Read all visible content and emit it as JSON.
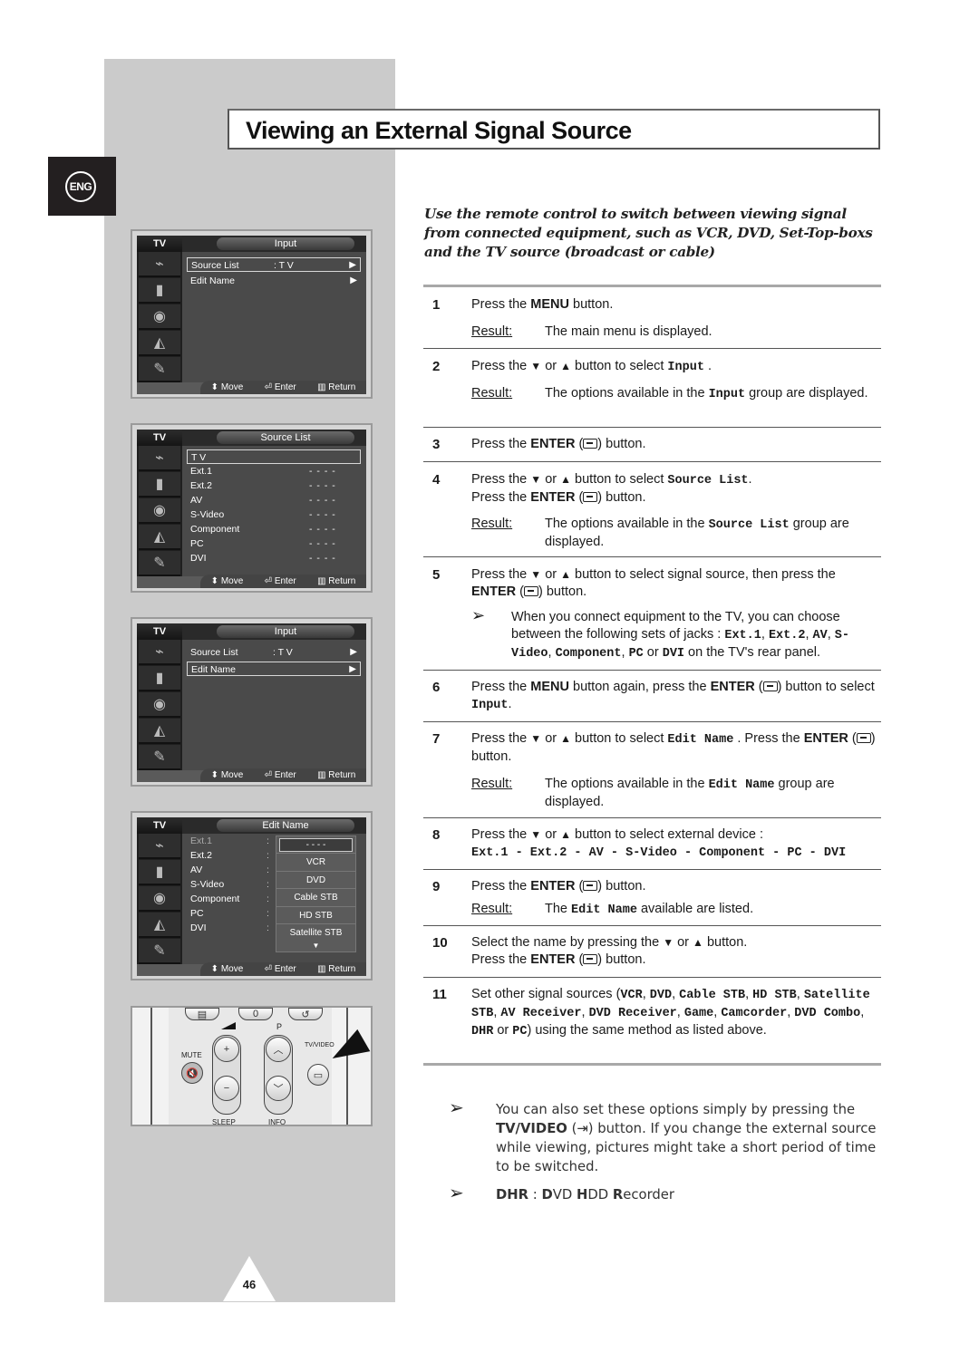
{
  "page": {
    "title": "Viewing an External Signal Source",
    "language_badge": "ENG",
    "page_number": "46"
  },
  "intro": "Use the remote control to switch between viewing signal from connected equipment, such as VCR, DVD, Set-Top-boxs and the TV source (broadcast or cable)",
  "osd_common": {
    "tv_label": "TV",
    "help_move": "Move",
    "help_enter": "Enter",
    "help_return": "Return",
    "side_icons": [
      "input-icon",
      "picture-icon",
      "sound-icon",
      "channel-icon",
      "setup-icon"
    ]
  },
  "osd1": {
    "header": "Input",
    "items": [
      {
        "label": "Source List",
        "value": ": T V",
        "arrow": "▶",
        "selected": true
      },
      {
        "label": "Edit Name",
        "value": "",
        "arrow": "▶",
        "selected": false
      }
    ]
  },
  "osd2": {
    "header": "Source List",
    "items": [
      {
        "label": "T V",
        "value": "",
        "selected": true
      },
      {
        "label": "Ext.1",
        "value": "- - - -"
      },
      {
        "label": "Ext.2",
        "value": "- - - -"
      },
      {
        "label": "AV",
        "value": "- - - -"
      },
      {
        "label": "S-Video",
        "value": "- - - -"
      },
      {
        "label": "Component",
        "value": "- - - -"
      },
      {
        "label": "PC",
        "value": "- - - -"
      },
      {
        "label": "DVI",
        "value": "- - - -"
      }
    ]
  },
  "osd3": {
    "header": "Input",
    "items": [
      {
        "label": "Source List",
        "value": ": T V",
        "arrow": "▶",
        "selected": false
      },
      {
        "label": "Edit Name",
        "value": "",
        "arrow": "▶",
        "selected": true
      }
    ]
  },
  "osd4": {
    "header": "Edit Name",
    "items": [
      {
        "label": "Ext.1",
        "colon": ":"
      },
      {
        "label": "Ext.2",
        "colon": ":"
      },
      {
        "label": "AV",
        "colon": ":"
      },
      {
        "label": "S-Video",
        "colon": ":"
      },
      {
        "label": "Component",
        "colon": ":"
      },
      {
        "label": "PC",
        "colon": ":"
      },
      {
        "label": "DVI",
        "colon": ":"
      }
    ],
    "dropdown_current": "- - - -",
    "dropdown_options": [
      "VCR",
      "DVD",
      "Cable STB",
      "HD STB",
      "Satellite STB"
    ],
    "dropdown_more": "▼"
  },
  "remote": {
    "mute_label": "MUTE",
    "p_label": "P",
    "tvvideo_label": "TV/VIDEO",
    "zero_label": "0",
    "sleep_label": "SLEEP",
    "info_label": "INFO"
  },
  "steps": [
    {
      "num": "1",
      "text_html": "Press the <b>MENU</b> button.",
      "result_label": "Result",
      "result_html": "The main menu is displayed."
    },
    {
      "num": "2",
      "text_html": "Press the <span class=\"tri\">▼</span> or <span class=\"tri\">▲</span> button to select <span class=\"mono\">Input</span> .",
      "result_label": "Result",
      "result_html": "The options available in the <span class=\"mono\">Input</span> group are displayed."
    },
    {
      "num": "3",
      "text_html": "Press the <b>ENTER</b> (<span class=\"enter-ic\"></span>) button."
    },
    {
      "num": "4",
      "text_html": "Press the <span class=\"tri\">▼</span> or <span class=\"tri\">▲</span> button to select <span class=\"mono\">Source List</span>.<br>Press the <b>ENTER</b> (<span class=\"enter-ic\"></span>) button.",
      "result_label": "Result",
      "result_html": "The options available in the <span class=\"mono\">Source List</span> group are displayed."
    },
    {
      "num": "5",
      "text_html": "Press the <span class=\"tri\">▼</span> or <span class=\"tri\">▲</span> button to select signal source, then press the <b>ENTER</b> (<span class=\"enter-ic\"></span>) button.",
      "note_html": "When you connect equipment to the TV, you can choose between the following sets of jacks : <span class=\"mono\">Ext.1</span>, <span class=\"mono\">Ext.2</span>, <span class=\"mono\">AV</span>, <span class=\"mono\">S-Video</span>, <span class=\"mono\">Component</span>, <span class=\"mono\">PC</span> or <span class=\"mono\">DVI</span>  on the TV's rear panel."
    },
    {
      "num": "6",
      "text_html": "Press the <b>MENU</b> button again, press the <b>ENTER</b> (<span class=\"enter-ic\"></span>) button to select <span class=\"mono\">Input</span>."
    },
    {
      "num": "7",
      "text_html": "Press the <span class=\"tri\">▼</span> or <span class=\"tri\">▲</span> button to select <span class=\"mono\">Edit Name</span> . Press the <b>ENTER</b> (<span class=\"enter-ic\"></span>) button.",
      "result_label": "Result",
      "result_html": "The options available in the <span class=\"mono\">Edit Name</span> group are displayed."
    },
    {
      "num": "8",
      "text_html": "Press the <span class=\"tri\">▼</span> or <span class=\"tri\">▲</span> button to select external device :<br><span class=\"mono\">Ext.1 - Ext.2 - AV - S-Video - Component - PC - DVI</span>"
    },
    {
      "num": "9",
      "text_html": "Press the <b>ENTER</b> (<span class=\"enter-ic\"></span>) button.",
      "result_label": "Result",
      "result_html": "The <span class=\"mono\">Edit Name</span> available are listed."
    },
    {
      "num": "10",
      "text_html": "Select the name by pressing the <span class=\"tri\">▼</span> or <span class=\"tri\">▲</span> button.<br>Press the <b>ENTER</b> (<span class=\"enter-ic\"></span>) button."
    },
    {
      "num": "11",
      "text_html": "Set other signal sources (<span class=\"mono\">VCR</span>, <span class=\"mono\">DVD</span>, <span class=\"mono\">Cable STB</span>, <span class=\"mono\">HD STB</span>, <span class=\"mono\">Satellite STB</span>, <span class=\"mono\">AV Receiver</span>, <span class=\"mono\">DVD Receiver</span>, <span class=\"mono\">Game</span>, <span class=\"mono\">Camcorder</span>, <span class=\"mono\">DVD Combo</span>, <span class=\"mono\">DHR</span> or <span class=\"mono\">PC</span>) using the same method as listed above."
    }
  ],
  "footnotes": [
    {
      "html": "You can also set these options simply by pressing the <b>TV/VIDEO</b> (<span style=\"font-family:'DejaVu Sans',sans-serif\">⇥</span>) button. If you change the external source while viewing, pictures might take a short period of time to be switched."
    },
    {
      "html": "<b>DHR</b> : <b>D</b>VD <b>H</b>DD <b>R</b>ecorder"
    }
  ],
  "note_arrow": "➢"
}
